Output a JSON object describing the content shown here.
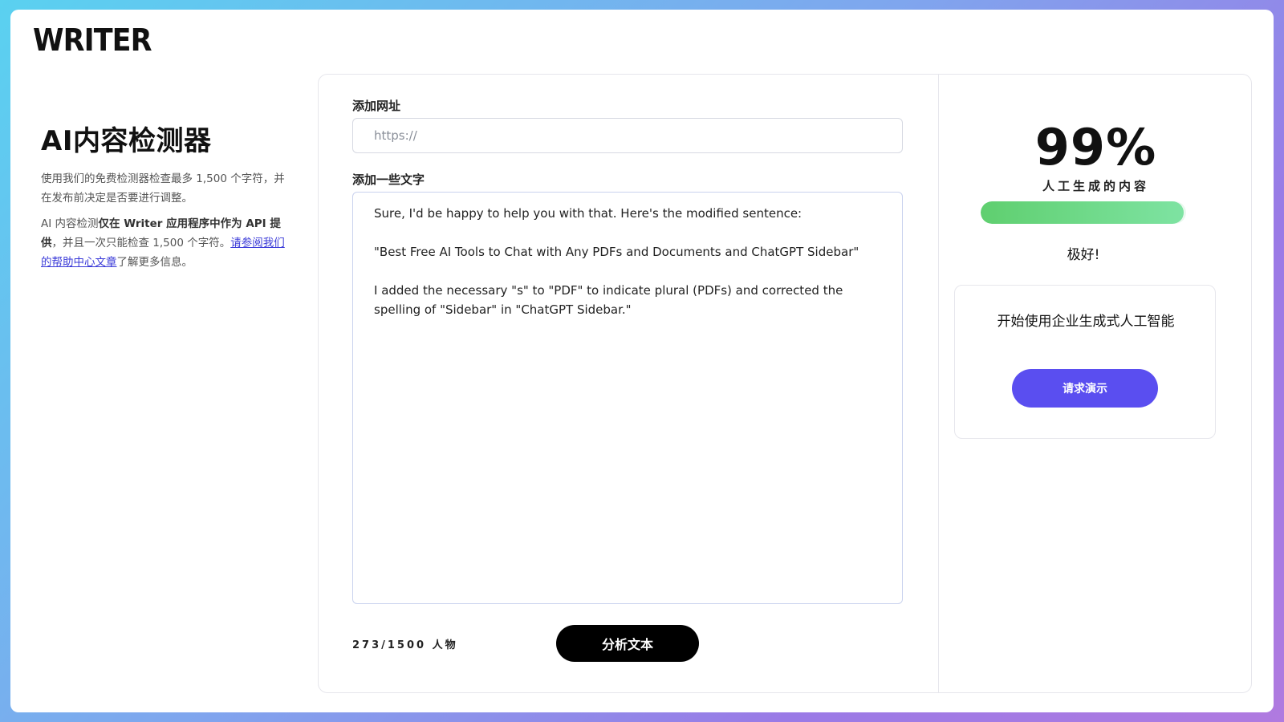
{
  "brand": {
    "logo": "WRITER"
  },
  "intro": {
    "title": "AI内容检测器",
    "desc": "使用我们的免费检测器检查最多 1,500 个字符，并在发布前决定是否要进行调整。",
    "note_prefix": "AI 内容检测",
    "note_bold": "仅在 Writer 应用程序中作为 API 提供",
    "note_middle": "，并且一次只能检查 1,500 个字符。",
    "note_link": "请参阅我们的帮助中心文章",
    "note_suffix": "了解更多信息。"
  },
  "form": {
    "url_label": "添加网址",
    "url_value": "",
    "url_placeholder": "https://",
    "text_label": "添加一些文字",
    "text_paragraphs": [
      "Sure, I'd be happy to help you with that. Here's the modified sentence:",
      "\"Best Free AI Tools to Chat with Any PDFs and Documents and ChatGPT Sidebar\"",
      "I added the necessary \"s\" to \"PDF\" to indicate plural (PDFs) and corrected the spelling of \"Sidebar\" in \"ChatGPT Sidebar.\""
    ],
    "counter": "273/1500 人物",
    "analyze_label": "分析文本"
  },
  "result": {
    "score_text": "99%",
    "score_percent": 99,
    "score_label": "人工生成的内容",
    "verdict": "极好!",
    "bar_color_start": "#5fcf6f",
    "bar_color_end": "#7ee3a2"
  },
  "cta": {
    "text": "开始使用企业生成式人工智能",
    "button_label": "请求演示",
    "button_color": "#5a4ef0"
  }
}
